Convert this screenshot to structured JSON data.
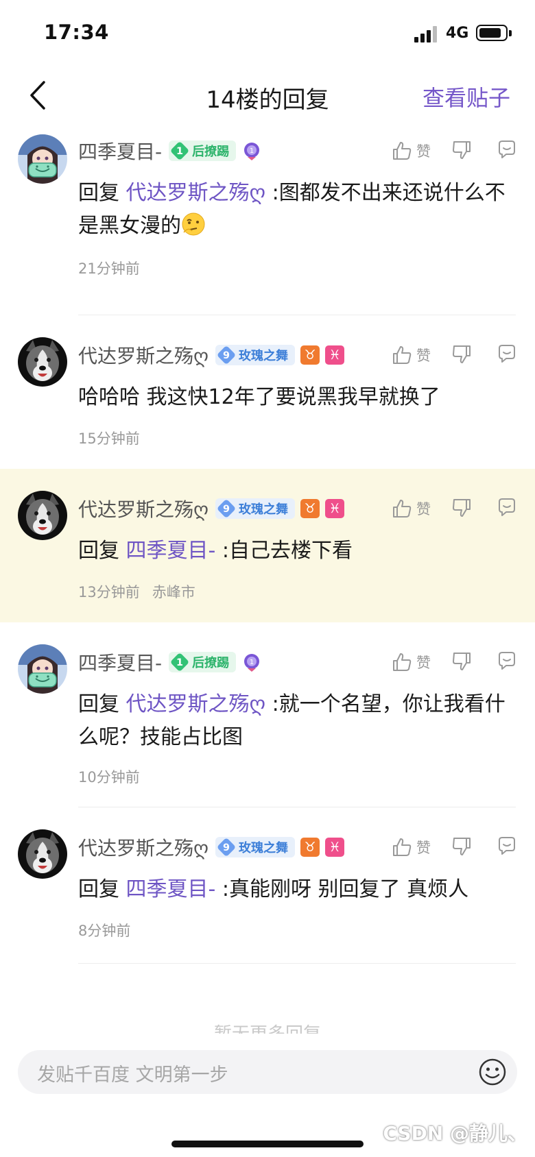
{
  "status_bar": {
    "time": "17:34",
    "network": "4G"
  },
  "header": {
    "title": "14楼的回复",
    "view_post": "查看贴子"
  },
  "replies": [
    {
      "username": "四季夏目-",
      "badge": {
        "level": "1",
        "name": "后撩踢"
      },
      "like_label": "赞",
      "prefix": "回复 ",
      "mention": "代达罗斯之殇ღ",
      "text": " :图都发不出来还说什么不是黑女漫的",
      "emoji": "thinking-emoji",
      "time": "21分钟前",
      "location": ""
    },
    {
      "username": "代达罗斯之殇ღ",
      "badge": {
        "level": "9",
        "name": "玫瑰之舞"
      },
      "zodiac": [
        "♉",
        "♓"
      ],
      "like_label": "赞",
      "text": "哈哈哈 我这快12年了要说黑我早就换了",
      "time": "15分钟前",
      "location": ""
    },
    {
      "username": "代达罗斯之殇ღ",
      "badge": {
        "level": "9",
        "name": "玫瑰之舞"
      },
      "zodiac": [
        "♉",
        "♓"
      ],
      "like_label": "赞",
      "prefix": "回复 ",
      "mention": "四季夏目-",
      "text": " :自己去楼下看",
      "time": "13分钟前",
      "location": "赤峰市",
      "highlight": true
    },
    {
      "username": "四季夏目-",
      "badge": {
        "level": "1",
        "name": "后撩踢"
      },
      "like_label": "赞",
      "prefix": "回复 ",
      "mention": "代达罗斯之殇ღ",
      "text": " :就一个名望，你让我看什么呢？技能占比图",
      "time": "10分钟前",
      "location": ""
    },
    {
      "username": "代达罗斯之殇ღ",
      "badge": {
        "level": "9",
        "name": "玫瑰之舞"
      },
      "zodiac": [
        "♉",
        "♓"
      ],
      "like_label": "赞",
      "prefix": "回复 ",
      "mention": "四季夏目-",
      "text": " :真能刚呀 别回复了 真烦人",
      "time": "8分钟前",
      "location": ""
    }
  ],
  "more_hint": "暂无更多回复",
  "input": {
    "placeholder": "发贴千百度 文明第一步"
  },
  "watermark": "CSDN @静儿、",
  "colors": {
    "accent": "#7557c9",
    "mention": "#6e55c4",
    "highlight_bg": "#fbf8e3",
    "meta_gray": "#999999"
  }
}
